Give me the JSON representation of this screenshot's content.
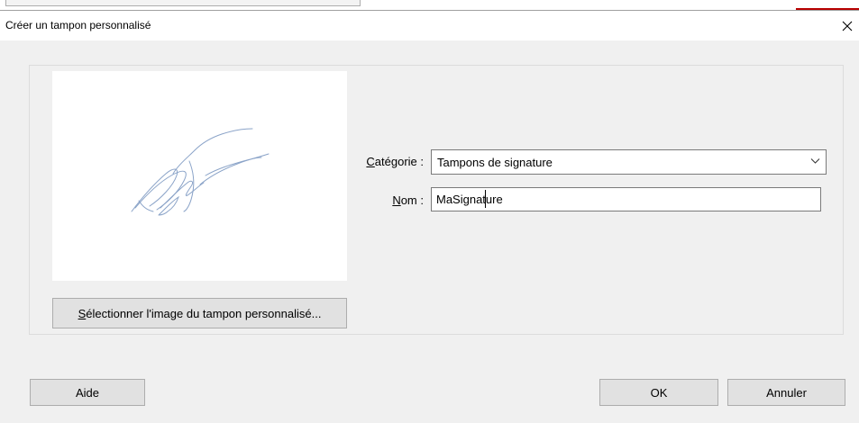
{
  "window": {
    "title": "Créer un tampon personnalisé"
  },
  "icons": {
    "close": "close-icon",
    "dropdown": "chevron-down-icon"
  },
  "form": {
    "category_label_mnemonic": "C",
    "category_label_rest": "atégorie :",
    "category_value": "Tampons de signature",
    "name_label_mnemonic": "N",
    "name_label_rest": "om :",
    "name_value": "MaSignature"
  },
  "preview": {
    "select_image_mnemonic": "S",
    "select_image_rest": "électionner l'image du tampon personnalisé..."
  },
  "buttons": {
    "help": "Aide",
    "ok": "OK",
    "cancel": "Annuler"
  },
  "colors": {
    "signature_ink": "#8aa3c8",
    "button_face": "#e1e1e1",
    "dialog_bg": "#f0f0f0"
  }
}
